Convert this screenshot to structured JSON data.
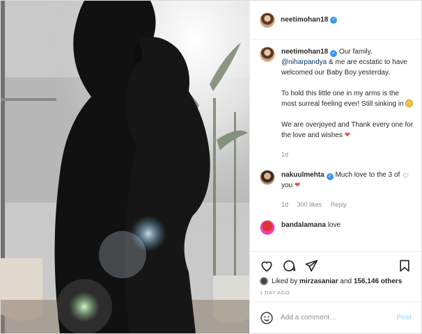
{
  "post": {
    "username": "neetimohan18",
    "verified_icon": "verified-badge-icon"
  },
  "caption": {
    "username": "neetimohan18",
    "line1": "Our family.",
    "mention": "@niharpandya",
    "line1_rest": " & me are ecstatic to have welcomed our Baby Boy yesterday.",
    "para2": "To hold this little one in my arms is the most surreal feeling ever! Still sinking in",
    "para3": "We are overjoyed and Thank every one for the love and wishes",
    "time": "1d"
  },
  "comment": {
    "username": "nakuulmehta",
    "text": "Much love to the 3 of you",
    "time": "1d",
    "likes": "300 likes",
    "reply": "Reply"
  },
  "third_comment_partial": {
    "username": "bandalamana",
    "text": "love"
  },
  "actions": {
    "liked_by_prefix": "Liked by ",
    "liked_by_user": "mirzasaniar",
    "liked_by_and": " and ",
    "liked_by_count": "156,146 others",
    "time_ago": "1 DAY AGO"
  },
  "comment_box": {
    "placeholder": "Add a comment…",
    "post_label": "Post"
  },
  "colors": {
    "link_blue": "#00376b",
    "verified_blue": "#3897f0",
    "post_disabled": "#b2dffc",
    "heart_red": "#ed4956"
  }
}
